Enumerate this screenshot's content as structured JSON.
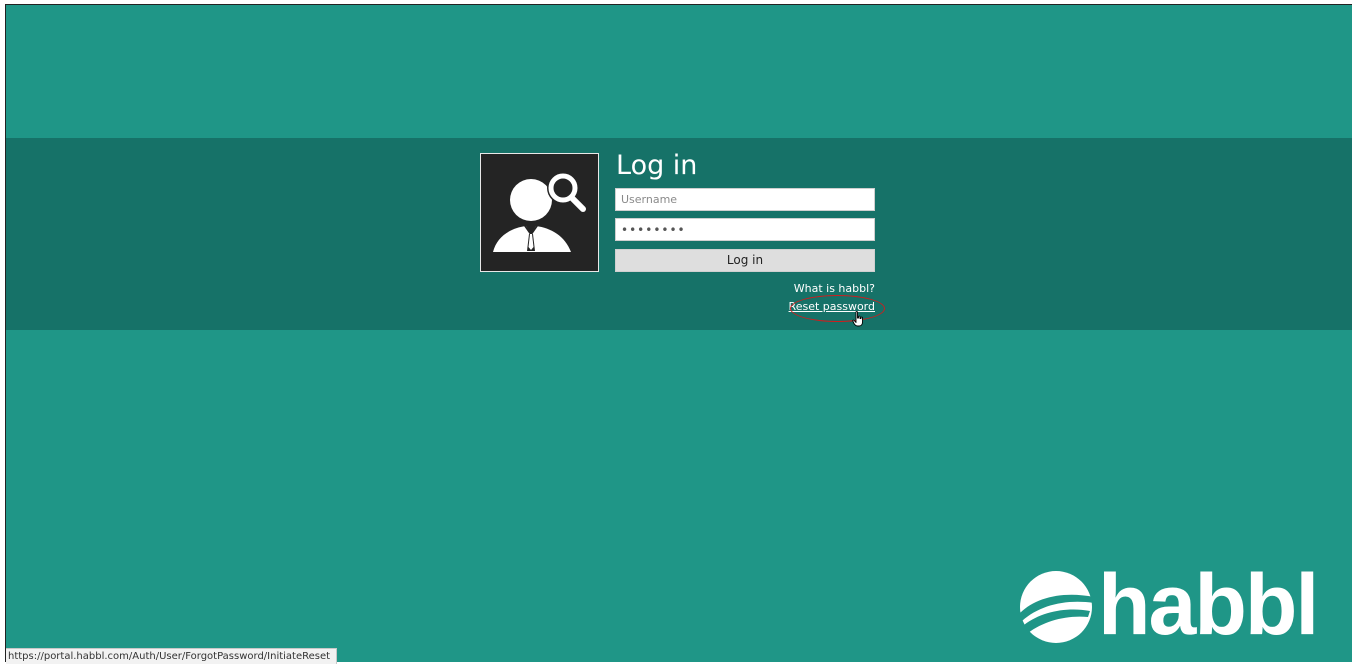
{
  "login": {
    "title": "Log in",
    "username_placeholder": "Username",
    "password_value": "12345678",
    "submit_label": "Log in"
  },
  "links": {
    "what_is": "What is habbl?",
    "reset_password": "Reset password"
  },
  "brand": {
    "name": "habbl"
  },
  "status_bar": {
    "url": "https://portal.habbl.com/Auth/User/ForgotPassword/InitiateReset"
  },
  "colors": {
    "background": "#1f9687",
    "band": "#167268",
    "avatar_bg": "#242424",
    "highlight": "#cc1f1f"
  },
  "icons": {
    "avatar": "user-search-icon",
    "cursor": "hand-pointer-icon",
    "logo": "habbl-logo-icon"
  }
}
